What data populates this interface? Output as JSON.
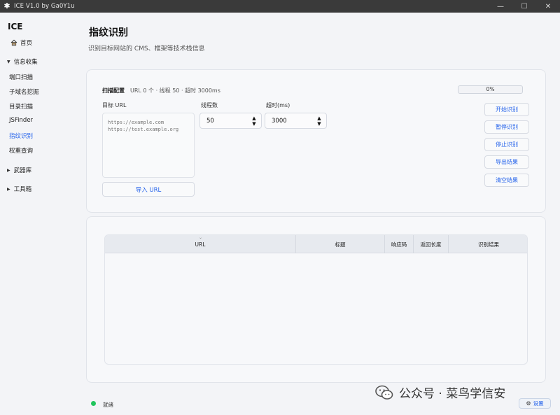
{
  "window": {
    "title": "ICE V1.0 by Ga0Y1u",
    "icon": "snowflake-icon",
    "controls": {
      "minimize": "—",
      "maximize": "☐",
      "close": "✕"
    }
  },
  "sidebar": {
    "brand": "ICE",
    "home": "首页",
    "groups": {
      "info": "信息收集",
      "weapons": "武器库",
      "tools": "工具箱"
    },
    "items": [
      "端口扫描",
      "子域名挖掘",
      "目录扫描",
      "JSFinder",
      "指纹识别",
      "权重查询"
    ],
    "active_item": "指纹识别"
  },
  "page": {
    "title": "指纹识别",
    "subtitle": "识别目标网站的 CMS、框架等技术栈信息"
  },
  "config": {
    "title": "扫描配置",
    "meta": "URL 0 个 · 线程 50 · 超时 3000ms",
    "progress": {
      "text": "0%",
      "value": 0
    },
    "target_label": "目标 URL",
    "target_placeholder": "https://example.com\nhttps://test.example.org",
    "import_label": "导入 URL",
    "threads_label": "线程数",
    "threads_value": "50",
    "timeout_label": "超时(ms)",
    "timeout_value": "3000",
    "buttons": {
      "start": "开始识别",
      "pause": "暂停识别",
      "stop": "停止识别",
      "export": "导出结果",
      "clear": "清空结果"
    }
  },
  "table": {
    "columns": [
      "URL",
      "标题",
      "响应码",
      "返回长度",
      "识别结果"
    ],
    "rows": []
  },
  "status": {
    "text": "就绪",
    "color": "#22c55e"
  },
  "watermark": "公众号 · 菜鸟学信安",
  "settings_label": "设置",
  "colors": {
    "accent": "#2563eb"
  }
}
